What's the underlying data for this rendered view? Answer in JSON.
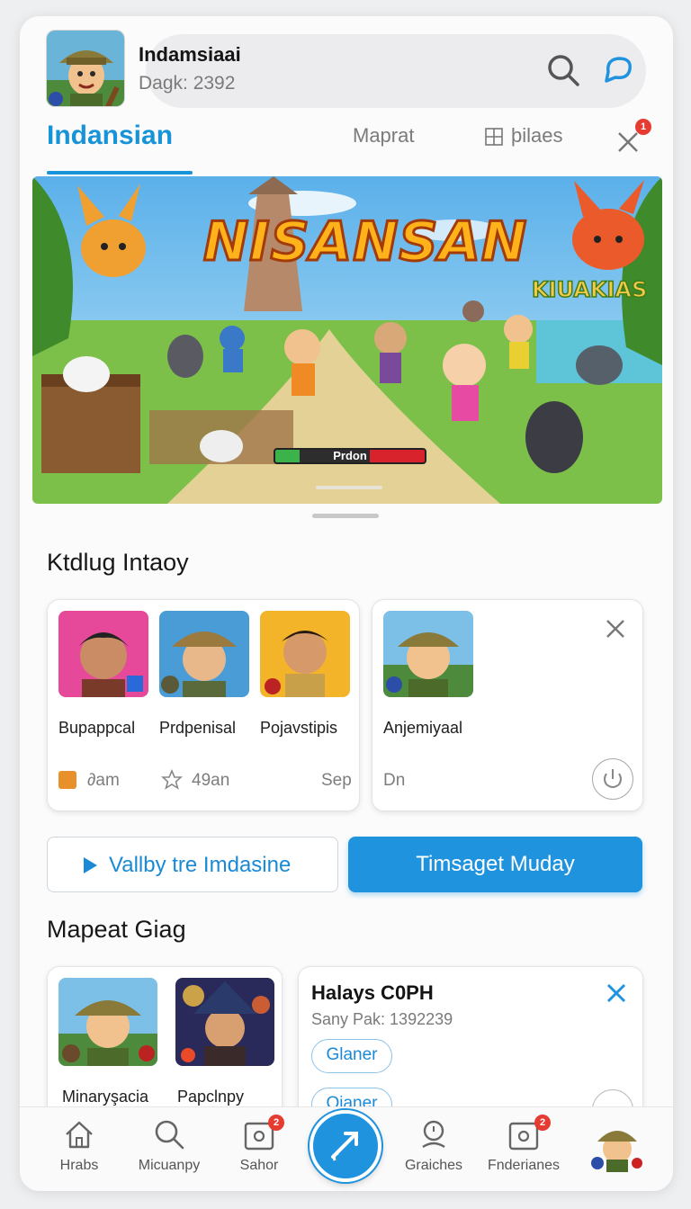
{
  "header": {
    "app_name": "Indamsiaai",
    "app_sub": "Dagk: 2392",
    "icons": [
      "search-icon",
      "chat-bubble-icon"
    ]
  },
  "tabs": {
    "active": "Indansian",
    "items": [
      {
        "label": "Maprat",
        "icon": ""
      },
      {
        "label": "þilaes",
        "icon": "grid-icon"
      }
    ],
    "close_badge": "1"
  },
  "hero": {
    "title": "NISANSAN",
    "side_logo": "KIUAKIAS",
    "bar_label": "Prdon",
    "bar_green_fraction": 0.16,
    "bar_red_fraction": 0.37
  },
  "section1": {
    "title": "Ktdlug Intaoy",
    "card_a": {
      "items": [
        {
          "caption": "Bupappcal"
        },
        {
          "caption": "Prdpenisal"
        },
        {
          "caption": "Pojavstipis"
        }
      ],
      "meta1": "∂am",
      "meta2": "49an",
      "meta3": "Sep"
    },
    "card_b": {
      "caption": "Anjemiyaal",
      "meta": "Dn"
    }
  },
  "buttons": {
    "outline_label": "Vallby tre Imdasine",
    "solid_label": "Timsaget Muday"
  },
  "section2": {
    "title": "Mapeat Giag",
    "card_a": {
      "items": [
        {
          "caption": "Minaryşacia"
        },
        {
          "caption": "Papclnpy"
        }
      ]
    },
    "card_b": {
      "title": "Halays C0PH",
      "sub": "Sany Pak: 1392239",
      "chips": [
        "Glaner",
        "Qianer"
      ]
    }
  },
  "bottom_nav": {
    "items": [
      {
        "label": "Hrabs",
        "icon": "home-icon",
        "badge": ""
      },
      {
        "label": "Micuanpy",
        "icon": "search-icon",
        "badge": ""
      },
      {
        "label": "Sahor",
        "icon": "camera-box-icon",
        "badge": "2"
      },
      {
        "label": "Graiches",
        "icon": "person-pin-icon",
        "badge": ""
      },
      {
        "label": "Fnderianes",
        "icon": "camera-box-icon",
        "badge": "2"
      }
    ]
  },
  "colors": {
    "accent": "#1f93de",
    "badge": "#e53b31"
  }
}
